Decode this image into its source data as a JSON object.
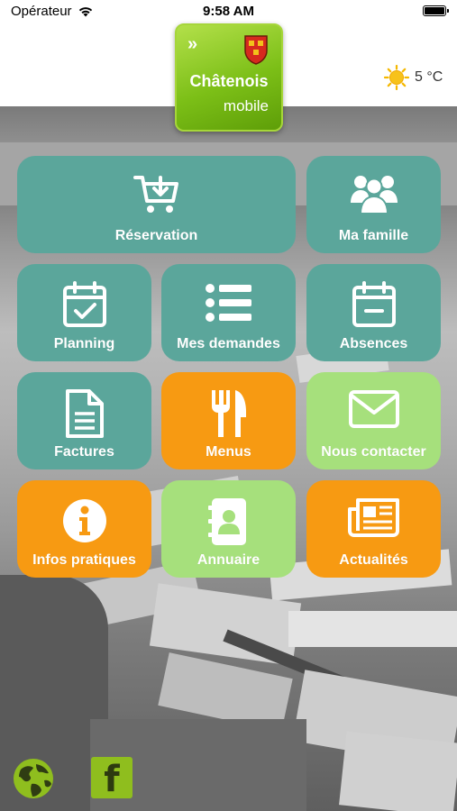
{
  "status_bar": {
    "carrier": "Opérateur",
    "time": "9:58 AM"
  },
  "header": {
    "logo_title": "Châtenois",
    "logo_subtitle": "mobile",
    "weather_temp": "5 °C",
    "weather_icon": "sun-icon"
  },
  "tiles": {
    "reservation": {
      "label": "Réservation",
      "icon": "cart-icon",
      "color": "#5ba69b"
    },
    "famille": {
      "label": "Ma famille",
      "icon": "family-icon",
      "color": "#5ba69b"
    },
    "planning": {
      "label": "Planning",
      "icon": "calendar-check-icon",
      "color": "#5ba69b"
    },
    "demandes": {
      "label": "Mes demandes",
      "icon": "list-icon",
      "color": "#5ba69b"
    },
    "absences": {
      "label": "Absences",
      "icon": "calendar-minus-icon",
      "color": "#5ba69b"
    },
    "factures": {
      "label": "Factures",
      "icon": "document-icon",
      "color": "#5ba69b"
    },
    "menus": {
      "label": "Menus",
      "icon": "fork-knife-icon",
      "color": "#f79a12"
    },
    "contact": {
      "label": "Nous contacter",
      "icon": "envelope-icon",
      "color": "#a6e07c"
    },
    "infos": {
      "label": "Infos pratiques",
      "icon": "info-icon",
      "color": "#f79a12"
    },
    "annuaire": {
      "label": "Annuaire",
      "icon": "address-book-icon",
      "color": "#a6e07c"
    },
    "actualites": {
      "label": "Actualités",
      "icon": "newspaper-icon",
      "color": "#f79a12"
    }
  },
  "footer": {
    "globe_icon": "globe-icon",
    "facebook_icon": "facebook-icon",
    "facebook_glyph": "f"
  }
}
